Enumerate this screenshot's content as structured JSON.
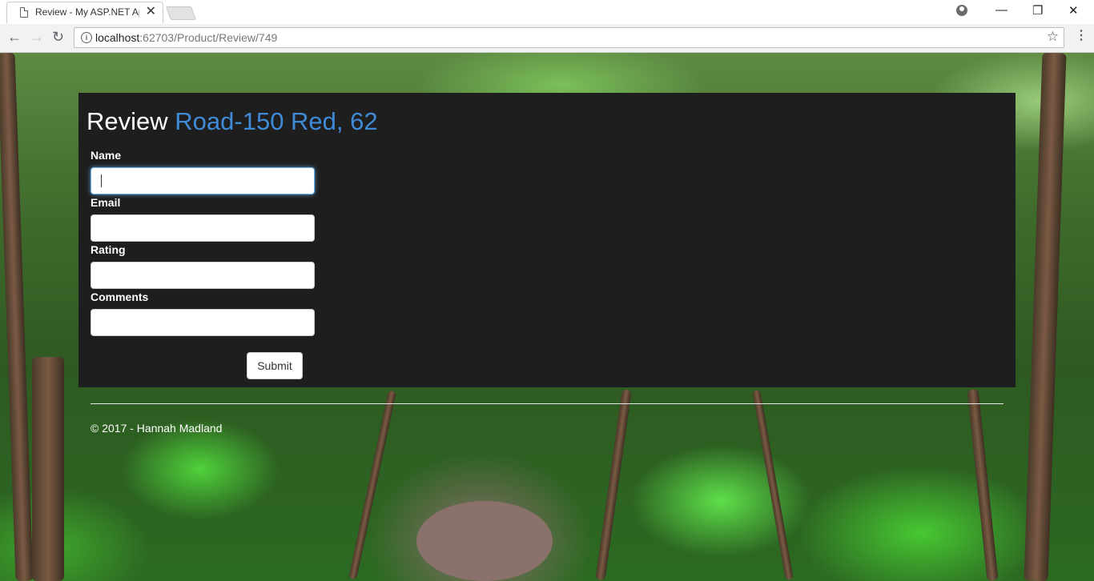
{
  "browser": {
    "tab_title": "Review - My ASP.NET Ap",
    "tab_close": "✕",
    "url_host": "localhost",
    "url_rest": ":62703/Product/Review/749",
    "icons": [
      "document-icon",
      "close-icon",
      "account-icon",
      "back-icon",
      "forward-icon",
      "reload-icon",
      "info-icon",
      "star-icon",
      "menu-icon"
    ],
    "window_controls": {
      "minimize": "—",
      "restore": "❐",
      "close": "✕"
    },
    "nav": {
      "back": "←",
      "forward": "→",
      "reload": "↻"
    },
    "info_glyph": "i",
    "star_glyph": "☆",
    "menu_glyph": "⋮"
  },
  "page": {
    "heading_prefix": "Review",
    "product_name": "Road-150 Red, 62",
    "form": {
      "name_label": "Name",
      "name_value": "",
      "email_label": "Email",
      "email_value": "",
      "rating_label": "Rating",
      "rating_value": "",
      "comments_label": "Comments",
      "comments_value": "",
      "submit_label": "Submit"
    },
    "footer": "© 2017 - Hannah Madland"
  },
  "colors": {
    "panel_bg": "#1e1e1e",
    "product_link": "#3f8bd8",
    "focus_ring": "#66afe9"
  }
}
